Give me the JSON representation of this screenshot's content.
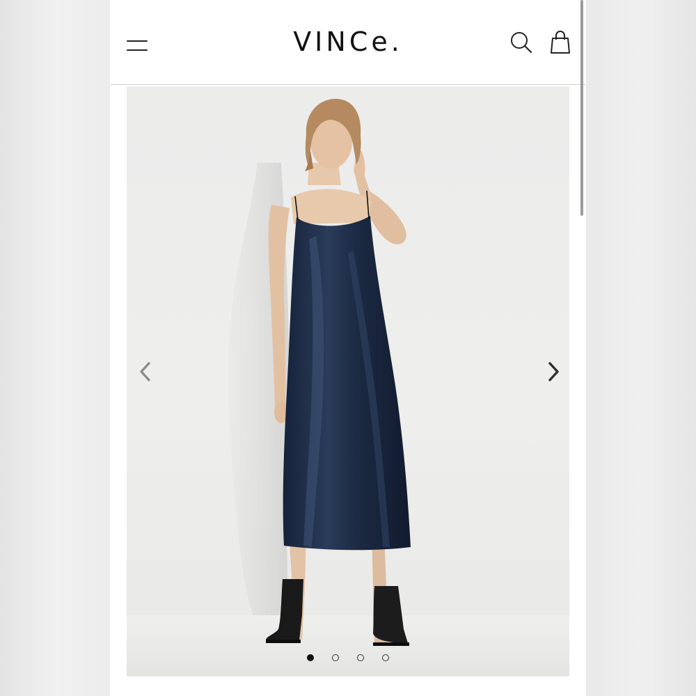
{
  "header": {
    "brand": "VINCe.",
    "menu_icon": "hamburger-menu-icon",
    "search_icon": "search-icon",
    "bag_icon": "shopping-bag-icon"
  },
  "gallery": {
    "image_count": 4,
    "active_index": 0,
    "prev_icon": "chevron-left-icon",
    "next_icon": "chevron-right-icon"
  },
  "colors": {
    "dress": "#1e2d44",
    "background": "#ececeb",
    "icon": "#222222"
  }
}
